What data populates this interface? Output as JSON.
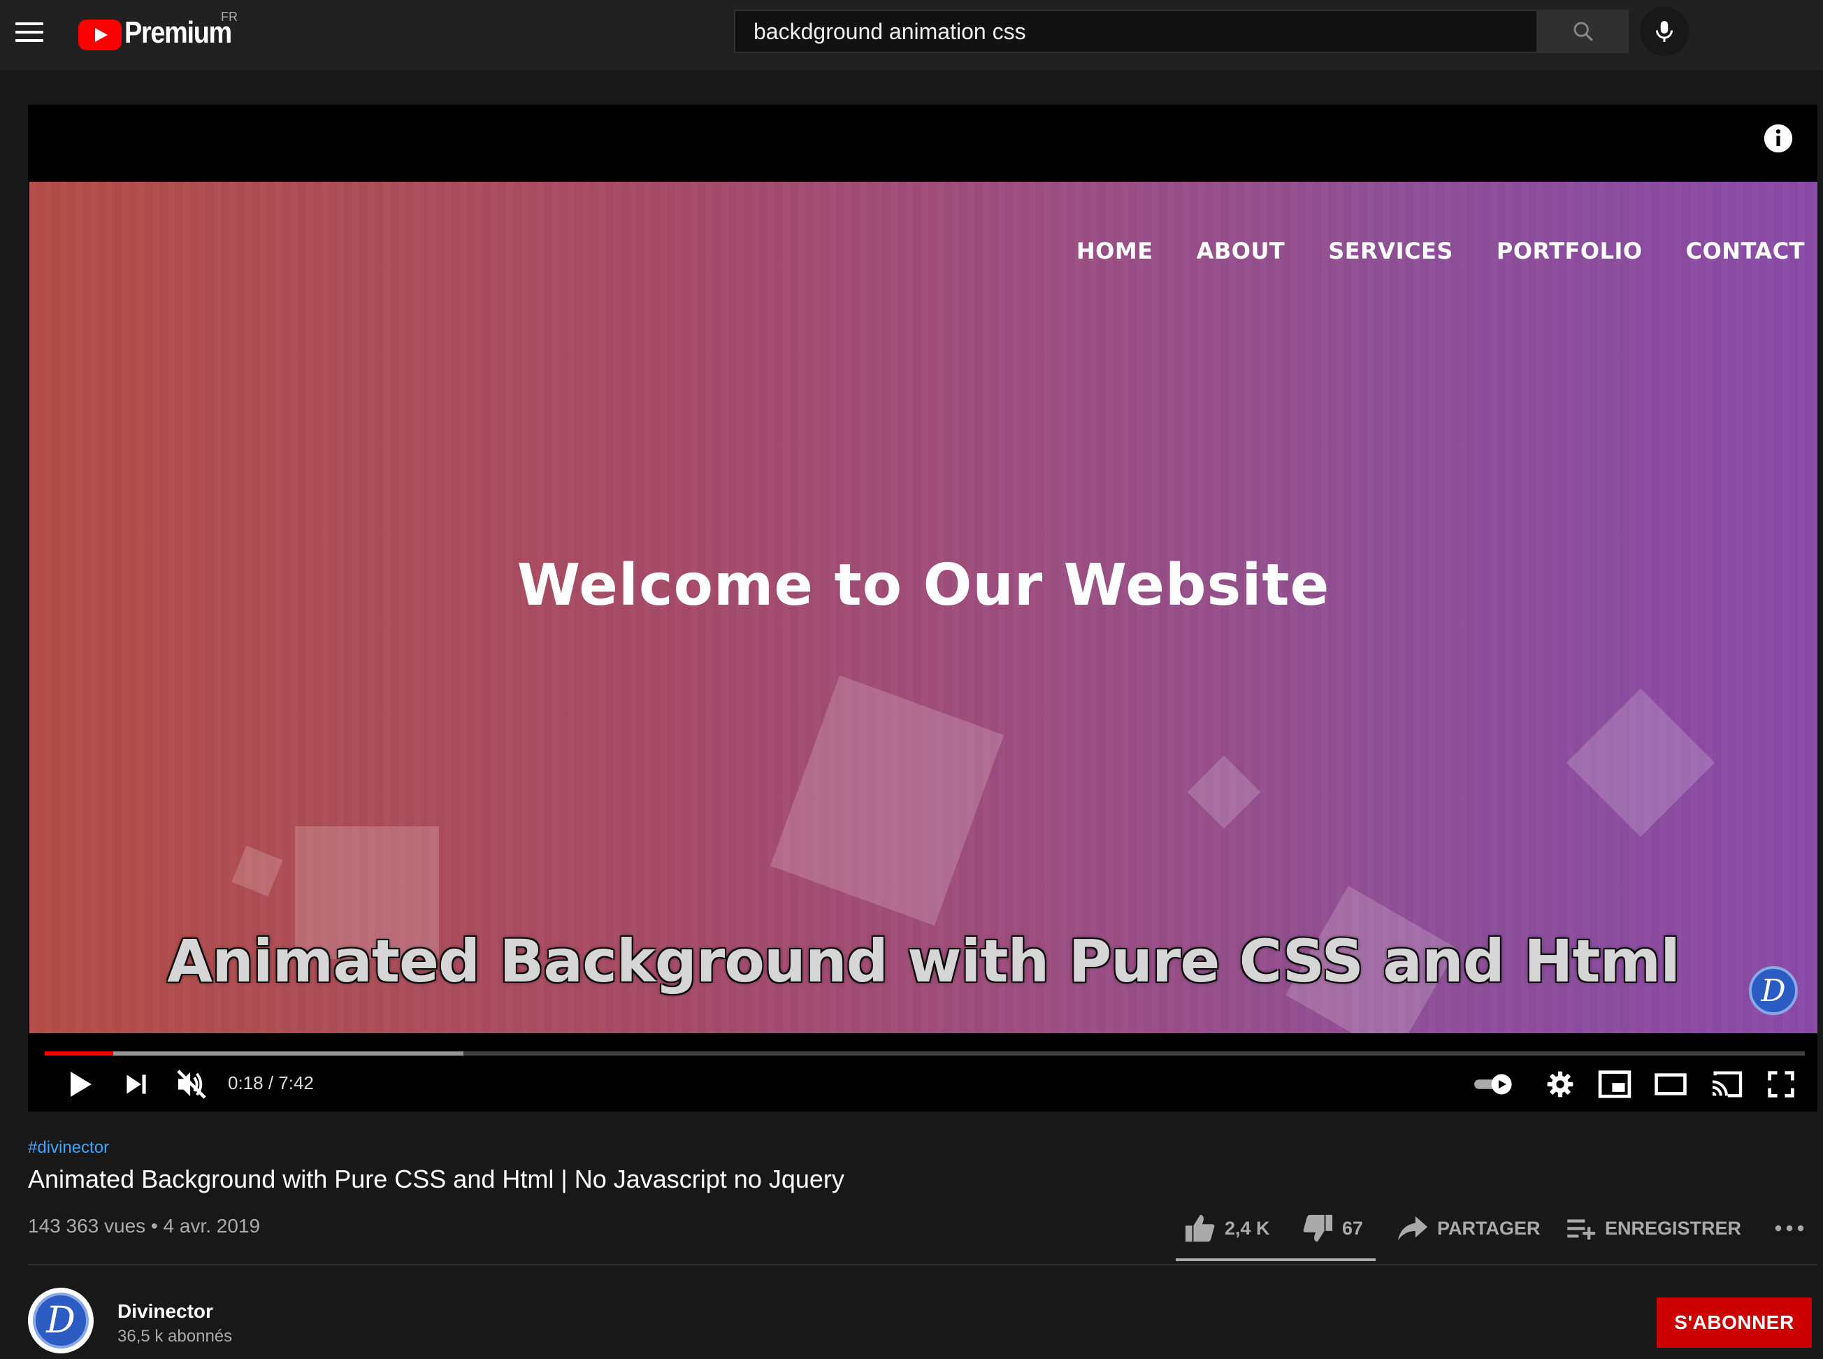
{
  "masthead": {
    "logo_text": "Premium",
    "region": "FR",
    "search": {
      "value": "backdground animation css"
    }
  },
  "video": {
    "frame_nav": [
      "HOME",
      "ABOUT",
      "SERVICES",
      "PORTFOLIO",
      "CONTACT"
    ],
    "frame_heading": "Welcome to Our Website",
    "frame_caption": "Animated Background with Pure CSS and Html",
    "watermark_letter": "D",
    "time_display": "0:18 / 7:42",
    "progress_played": 0.039,
    "progress_buffered": 0.238,
    "autoplay_on": true,
    "muted": true
  },
  "info": {
    "hashtag": "#divinector",
    "title": "Animated Background with Pure CSS and Html | No Javascript no Jquery",
    "views": "143 363 vues",
    "separator": "•",
    "date": "4 avr. 2019",
    "actions": {
      "like": "2,4 K",
      "dislike": "67",
      "share": "PARTAGER",
      "save": "ENREGISTRER"
    }
  },
  "channel": {
    "avatar_letter": "D",
    "name": "Divinector",
    "subscribers": "36,5 k abonnés",
    "subscribe_label": "S'ABONNER"
  },
  "colors": {
    "background": "#181818",
    "masthead": "#212121",
    "accent_red": "#ff0000",
    "subscribe": "#cc0000",
    "link_blue": "#3ea6ff"
  },
  "icons": [
    "menu-icon",
    "youtube-logo-icon",
    "search-icon",
    "mic-icon",
    "info-icon",
    "play-icon",
    "next-icon",
    "volume-muted-icon",
    "autoplay-toggle-icon",
    "settings-icon",
    "miniplayer-icon",
    "theater-icon",
    "cast-icon",
    "fullscreen-icon",
    "thumbs-up-icon",
    "thumbs-down-icon",
    "share-icon",
    "playlist-add-icon",
    "more-icon"
  ]
}
